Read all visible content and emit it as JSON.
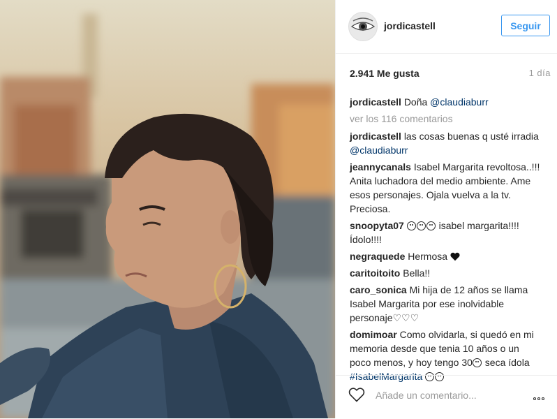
{
  "post": {
    "username": "jordicastell",
    "follow_label": "Seguir",
    "likes": "2.941 Me gusta",
    "time": "1 día",
    "caption": {
      "user": "jordicastell",
      "text": "Doña ",
      "mention": "@claudiaburr"
    },
    "view_all": "ver los 116 comentarios",
    "comments": [
      {
        "user": "jordicastell",
        "text": "las cosas buenas q usté irradia ",
        "mention": "@claudiaburr"
      },
      {
        "user": "jeannycanals",
        "text": "Isabel Margarita revoltosa..!!! Anita luchadora del medio ambiente. Ame esos personajes. Ojala vuelva a la tv. Preciosa."
      },
      {
        "user": "snoopyta07",
        "text": "isabel margarita!!!! Ídolo!!!!"
      },
      {
        "user": "negraquede",
        "text": "Hermosa"
      },
      {
        "user": "caritoitoito",
        "text": "Bella!!"
      },
      {
        "user": "caro_sonica",
        "text": "Mi hija de 12 años se llama Isabel Margarita por ese inolvidable personaje♡♡♡"
      },
      {
        "user": "domimoar",
        "text": "Como olvidarla, si quedó en mi memoria desde que tenia 10 años o un poco menos, y hoy tengo 30",
        "text2": " seca ídola ",
        "hashtag": "#IsabelMargarita"
      }
    ],
    "add_comment_placeholder": "Añade un comentario...",
    "colors": {
      "link": "#003569",
      "accent": "#3897f0",
      "muted": "#999999"
    }
  }
}
